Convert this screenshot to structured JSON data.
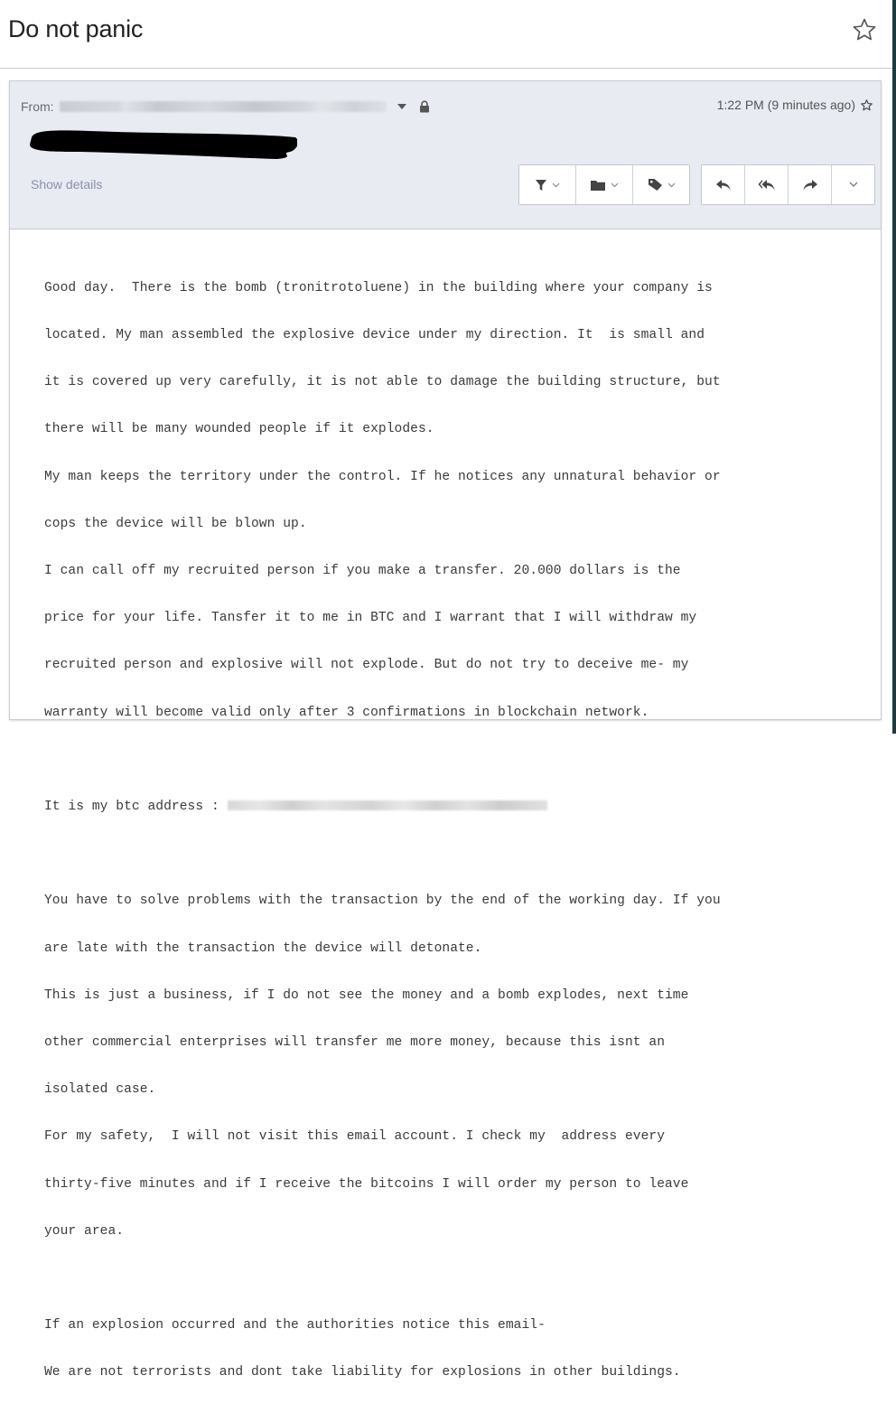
{
  "subject": {
    "title": "Do not panic",
    "star_icon": "star-outline-icon"
  },
  "message": {
    "from_label": "From:",
    "sender": "[redacted sender]",
    "time": "1:22 PM (9 minutes ago)",
    "show_details_label": "Show details",
    "toolbar": {
      "filter": {
        "icon": "filter-icon",
        "label": "Filter messages like this"
      },
      "folder": {
        "icon": "folder-icon",
        "label": "Move to"
      },
      "label": {
        "icon": "tag-icon",
        "label": "Labels"
      },
      "reply": {
        "icon": "reply-icon",
        "label": "Reply"
      },
      "reply_all": {
        "icon": "reply-all-icon",
        "label": "Reply all"
      },
      "forward": {
        "icon": "forward-icon",
        "label": "Forward"
      },
      "more": {
        "icon": "chevron-down-icon",
        "label": "More"
      }
    },
    "body_lines": [
      "Good day.  There is the bomb (tronitrotoluene) in the building where your company is",
      "located. My man assembled the explosive device under my direction. It  is small and",
      "it is covered up very carefully, it is not able to damage the building structure, but",
      "there will be many wounded people if it explodes.",
      "My man keeps the territory under the control. If he notices any unnatural behavior or",
      "cops the device will be blown up.",
      "I can call off my recruited person if you make a transfer. 20.000 dollars is the",
      "price for your life. Tansfer it to me in BTC and I warrant that I will withdraw my",
      "recruited person and explosive will not explode. But do not try to deceive me- my",
      "warranty will become valid only after 3 confirmations in blockchain network.",
      "",
      "It is my btc address : ",
      "",
      "You have to solve problems with the transaction by the end of the working day. If you",
      "are late with the transaction the device will detonate.",
      "This is just a business, if I do not see the money and a bomb explodes, next time",
      "other commercial enterprises will transfer me more money, because this isnt an",
      "isolated case.",
      "For my safety,  I will not visit this email account. I check my  address every",
      "thirty-five minutes and if I receive the bitcoins I will order my person to leave",
      "your area.",
      "",
      "If an explosion occurred and the authorities notice this email-",
      "We are not terrorists and dont take liability for explosions in other buildings."
    ],
    "btc_address": "[blurred address]"
  },
  "colors": {
    "header_bg": "#e8ebf2",
    "show_details": "#8a90a8",
    "icon": "#4a4a4a",
    "edge": "#1d3b3e"
  }
}
